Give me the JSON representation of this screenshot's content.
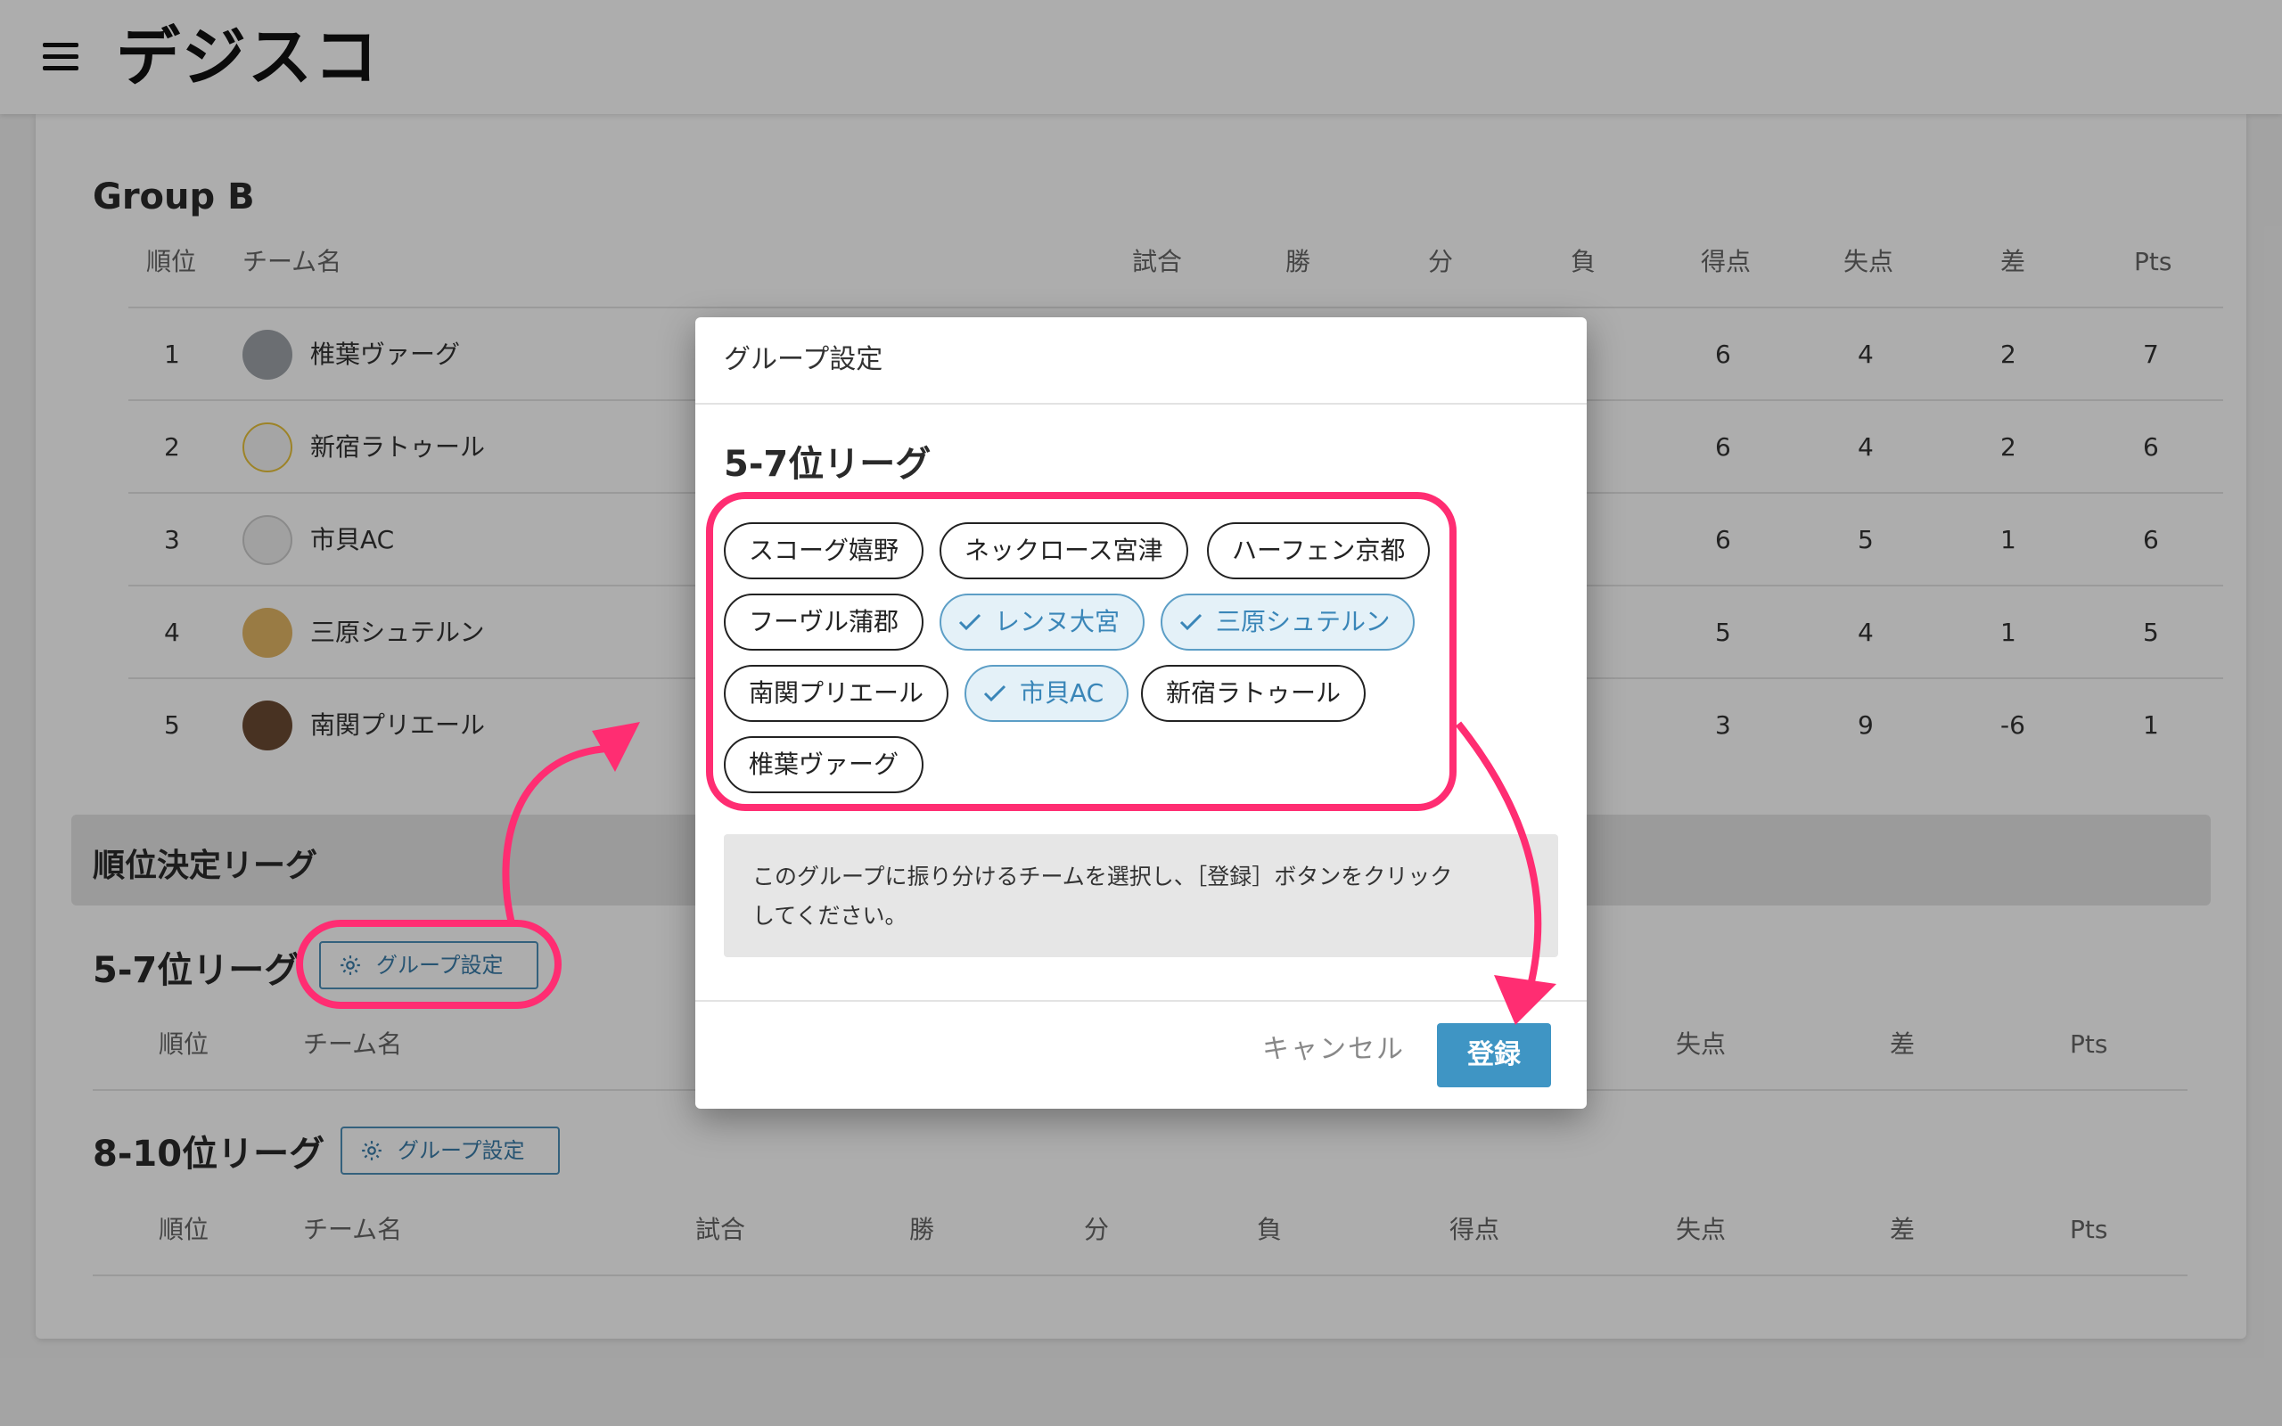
{
  "app": {
    "logo": "デジスコ"
  },
  "group_b": {
    "title": "Group B",
    "headers": [
      "順位",
      "チーム名",
      "試合",
      "勝",
      "分",
      "負",
      "得点",
      "失点",
      "差",
      "Pts"
    ],
    "rows": [
      {
        "rank": "1",
        "team": "椎葉ヴァーグ",
        "gf": "6",
        "ga": "4",
        "gd": "2",
        "pts": "7"
      },
      {
        "rank": "2",
        "team": "新宿ラトゥール",
        "gf": "6",
        "ga": "4",
        "gd": "2",
        "pts": "6"
      },
      {
        "rank": "3",
        "team": "市貝AC",
        "gf": "6",
        "ga": "5",
        "gd": "1",
        "pts": "6"
      },
      {
        "rank": "4",
        "team": "三原シュテルン",
        "gf": "5",
        "ga": "4",
        "gd": "1",
        "pts": "5"
      },
      {
        "rank": "5",
        "team": "南関プリエール",
        "gf": "3",
        "ga": "9",
        "gd": "-6",
        "pts": "1"
      }
    ]
  },
  "placement": {
    "title": "順位決定リーグ",
    "league_57": {
      "title": "5-7位リーグ",
      "button": "グループ設定",
      "headers": [
        "順位",
        "チーム名",
        "失点",
        "差",
        "Pts"
      ]
    },
    "league_810": {
      "title": "8-10位リーグ",
      "button": "グループ設定",
      "headers": [
        "順位",
        "チーム名",
        "試合",
        "勝",
        "分",
        "負",
        "得点",
        "失点",
        "差",
        "Pts"
      ]
    }
  },
  "dialog": {
    "title": "グループ設定",
    "heading": "5-7位リーグ",
    "chips": [
      {
        "label": "スコーグ嬉野",
        "selected": false
      },
      {
        "label": "ネックロース宮津",
        "selected": false
      },
      {
        "label": "ハーフェン京都",
        "selected": false
      },
      {
        "label": "フーヴル蒲郡",
        "selected": false
      },
      {
        "label": "レンヌ大宮",
        "selected": true
      },
      {
        "label": "三原シュテルン",
        "selected": true
      },
      {
        "label": "南関プリエール",
        "selected": false
      },
      {
        "label": "市貝AC",
        "selected": true
      },
      {
        "label": "新宿ラトゥール",
        "selected": false
      },
      {
        "label": "椎葉ヴァーグ",
        "selected": false
      }
    ],
    "help_line1": "このグループに振り分けるチームを選択し、［登録］ボタンをクリック",
    "help_line2": "してください。",
    "cancel": "キャンセル",
    "register": "登録"
  },
  "colors": {
    "accent": "#3f95c4",
    "highlight": "#ff2d72",
    "chip_selected_bg": "#e4f1f8"
  }
}
